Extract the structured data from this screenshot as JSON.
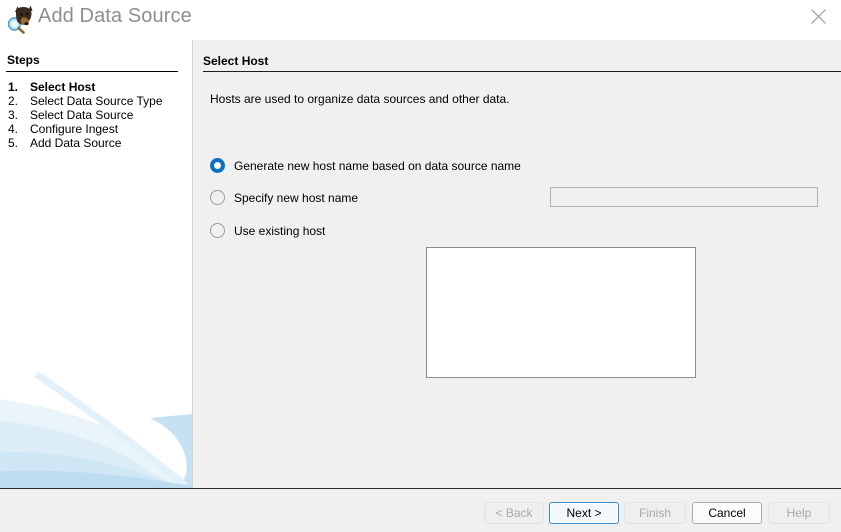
{
  "window": {
    "title": "Add Data Source",
    "logo_icon": "autopsy-dog-magnifier-icon",
    "close_icon": "close-icon"
  },
  "sidebar": {
    "heading": "Steps",
    "steps": [
      {
        "number": "1.",
        "label": "Select Host",
        "current": true
      },
      {
        "number": "2.",
        "label": "Select Data Source Type",
        "current": false
      },
      {
        "number": "3.",
        "label": "Select Data Source",
        "current": false
      },
      {
        "number": "4.",
        "label": "Configure Ingest",
        "current": false
      },
      {
        "number": "5.",
        "label": "Add Data Source",
        "current": false
      }
    ]
  },
  "main": {
    "title": "Select Host",
    "description": "Hosts are used to organize data sources and other data.",
    "options": [
      {
        "label": "Generate new host name based on data source name",
        "selected": true
      },
      {
        "label": "Specify new host name",
        "selected": false
      },
      {
        "label": "Use existing host",
        "selected": false
      }
    ],
    "host_name_field": {
      "value": "",
      "placeholder": ""
    },
    "existing_host_list": {
      "items": []
    }
  },
  "footer": {
    "buttons": [
      {
        "id": "back",
        "label": "< Back",
        "state": "disabled"
      },
      {
        "id": "next",
        "label": "Next >",
        "state": "default"
      },
      {
        "id": "finish",
        "label": "Finish",
        "state": "disabled"
      },
      {
        "id": "cancel",
        "label": "Cancel",
        "state": "enabled"
      },
      {
        "id": "help",
        "label": "Help",
        "state": "disabled"
      }
    ]
  },
  "colors": {
    "accent": "#0d6fc4",
    "panel": "#f0f0f0",
    "title_text": "#8e8e8e",
    "swoosh": "#cfe4f2"
  }
}
